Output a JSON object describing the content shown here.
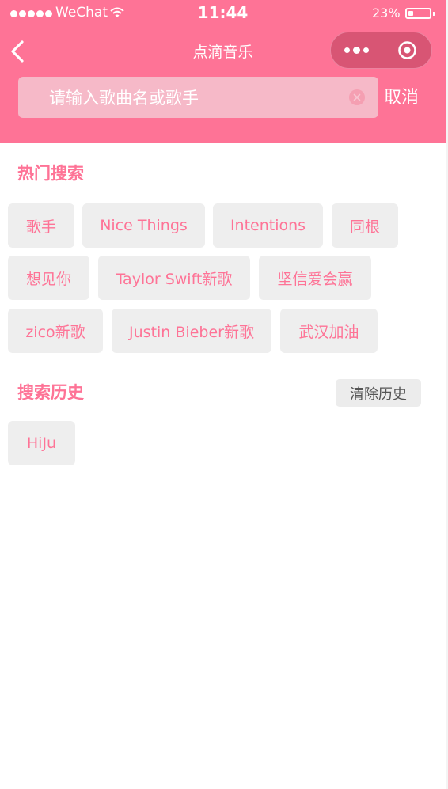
{
  "status_bar": {
    "carrier": "WeChat",
    "time": "11:44",
    "battery_percent": "23%",
    "battery_level": 0.23
  },
  "nav": {
    "title": "点滴音乐",
    "back_icon": "chevron-left-icon",
    "more_icon": "more-dots-icon",
    "close_icon": "target-circle-icon"
  },
  "search": {
    "placeholder": "请输入歌曲名或歌手",
    "value": "",
    "cancel_label": "取消"
  },
  "hot": {
    "title": "热门搜索",
    "tags": [
      "歌手",
      "Nice Things",
      "Intentions",
      "同根",
      "想见你",
      "Taylor Swift新歌",
      "坚信爱会赢",
      "zico新歌",
      "Justin Bieber新歌",
      "武汉加油"
    ]
  },
  "history": {
    "title": "搜索历史",
    "clear_label": "清除历史",
    "items": [
      "HiJu"
    ]
  },
  "colors": {
    "accent": "#fe7396",
    "tag_bg": "#eeeeee",
    "search_bg": "#f6b9c8"
  }
}
